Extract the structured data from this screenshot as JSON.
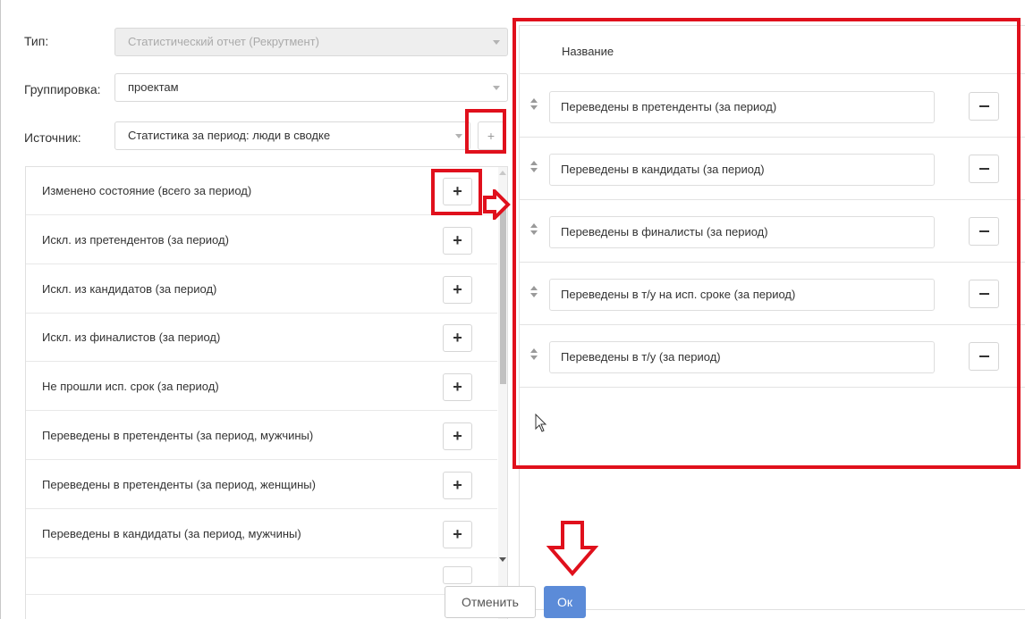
{
  "form": {
    "type_label": "Тип:",
    "type_value": "Статистический отчет (Рекрутмент)",
    "grouping_label": "Группировка:",
    "grouping_value": "проектам",
    "source_label": "Источник:",
    "source_value": "Статистика за период: люди в сводке",
    "add_source_glyph": "+"
  },
  "available_list": {
    "add_glyph": "+",
    "items": [
      "Изменено состояние (всего за период)",
      "Искл. из претендентов (за период)",
      "Искл. из кандидатов (за период)",
      "Искл. из финалистов (за период)",
      "Не прошли исп. срок (за период)",
      "Переведены в претенденты (за период, мужчины)",
      "Переведены в претенденты (за период, женщины)",
      "Переведены в кандидаты (за период, мужчины)"
    ]
  },
  "selected_panel": {
    "header": "Название",
    "rows": [
      "Переведены в претенденты (за период)",
      "Переведены в кандидаты (за период)",
      "Переведены в финалисты (за период)",
      "Переведены в т/у на исп. сроке (за период)",
      "Переведены в т/у (за период)"
    ]
  },
  "footer": {
    "cancel_label": "Отменить",
    "ok_label": "Ок"
  },
  "colors": {
    "annotation_red": "#e0101c",
    "primary_blue": "#5b8bd8"
  }
}
